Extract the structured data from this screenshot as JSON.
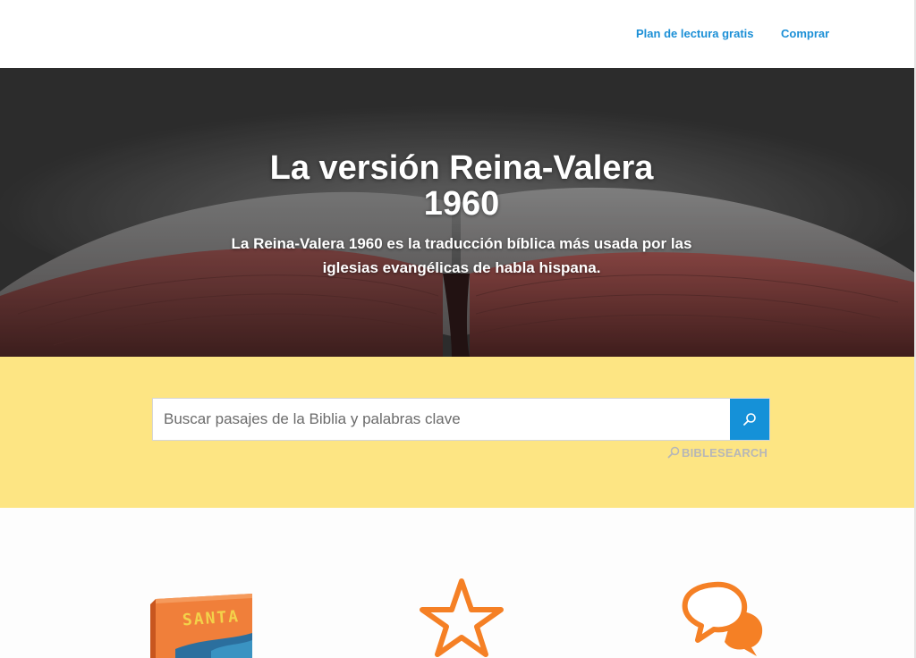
{
  "nav": {
    "plan_label": "Plan de lectura gratis",
    "buy_label": "Comprar"
  },
  "hero": {
    "title": "La versión Reina-Valera 1960",
    "subtitle": "La Reina-Valera 1960 es la traducción bíblica más usada por las iglesias evangélicas de habla hispana."
  },
  "search": {
    "placeholder": "Buscar pasajes de la Biblia y palabras clave",
    "button_icon": "search-icon",
    "powered_by": "BIBLESEARCH"
  },
  "features": {
    "bible_cover_text": "SANTA",
    "icons": [
      "bible-book-icon",
      "star-icon",
      "chat-bubbles-icon"
    ]
  },
  "colors": {
    "link": "#1b8fd6",
    "search_band": "#fde583",
    "search_button": "#1591d8",
    "icon_orange": "#f58025"
  }
}
